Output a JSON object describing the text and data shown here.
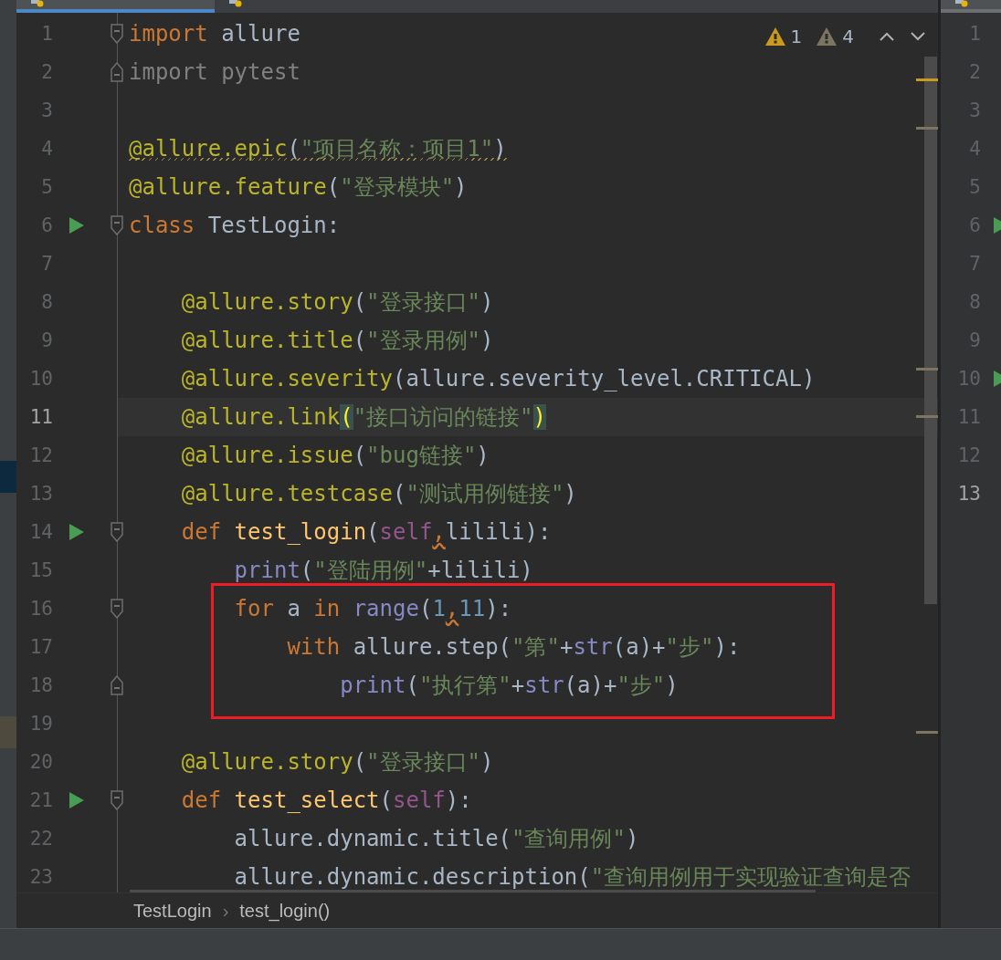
{
  "editor_tabs": [
    {
      "selected": true
    },
    {
      "selected": false
    }
  ],
  "inspections": [
    {
      "kind": "warning",
      "count": "1"
    },
    {
      "kind": "weak-warning",
      "count": "4"
    }
  ],
  "lines": [
    {
      "number": "1",
      "run": false,
      "fold_start": true,
      "fold_end": false,
      "current": false,
      "warned": false,
      "tokens": [
        {
          "kind": "kw",
          "text": "import"
        },
        {
          "kind": "ident",
          "text": " allure"
        }
      ]
    },
    {
      "number": "2",
      "run": false,
      "fold_start": false,
      "fold_end": true,
      "current": false,
      "warned": false,
      "tokens": [
        {
          "kind": "dim",
          "text": "import pytest"
        }
      ]
    },
    {
      "number": "3",
      "run": false,
      "fold_start": false,
      "fold_end": false,
      "current": false
    },
    {
      "number": "4",
      "run": false,
      "fold_start": false,
      "fold_end": false,
      "current": false,
      "warned": true,
      "tokens": [
        {
          "kind": "deco",
          "text": "@allure.epic"
        },
        {
          "kind": "ident",
          "text": "("
        },
        {
          "kind": "str",
          "text": "\"项目名称：项目1\""
        },
        {
          "kind": "ident",
          "text": ")"
        }
      ]
    },
    {
      "number": "5",
      "run": false,
      "fold_start": false,
      "fold_end": false,
      "current": false,
      "warned": false,
      "tokens": [
        {
          "kind": "deco",
          "text": "@allure.feature"
        },
        {
          "kind": "ident",
          "text": "("
        },
        {
          "kind": "str",
          "text": "\"登录模块\""
        },
        {
          "kind": "ident",
          "text": ")"
        }
      ]
    },
    {
      "number": "6",
      "run": true,
      "fold_start": true,
      "fold_end": false,
      "current": false,
      "warned": false,
      "tokens": [
        {
          "kind": "kw",
          "text": "class"
        },
        {
          "kind": "ident",
          "text": " TestLogin:"
        }
      ]
    },
    {
      "number": "7",
      "run": false,
      "fold_start": false,
      "fold_end": false,
      "current": false
    },
    {
      "number": "8",
      "run": false,
      "fold_start": false,
      "fold_end": false,
      "current": false,
      "warned": false,
      "tokens": [
        {
          "kind": "deco",
          "text": "    @allure.story"
        },
        {
          "kind": "ident",
          "text": "("
        },
        {
          "kind": "str",
          "text": "\"登录接口\""
        },
        {
          "kind": "ident",
          "text": ")"
        }
      ]
    },
    {
      "number": "9",
      "run": false,
      "fold_start": false,
      "fold_end": false,
      "current": false,
      "warned": false,
      "tokens": [
        {
          "kind": "deco",
          "text": "    @allure.title"
        },
        {
          "kind": "ident",
          "text": "("
        },
        {
          "kind": "str",
          "text": "\"登录用例\""
        },
        {
          "kind": "ident",
          "text": ")"
        }
      ]
    },
    {
      "number": "10",
      "run": false,
      "fold_start": false,
      "fold_end": false,
      "current": false,
      "warned": false,
      "tokens": [
        {
          "kind": "deco",
          "text": "    @allure.severity"
        },
        {
          "kind": "ident",
          "text": "(allure.severity_level.CRITICAL)"
        }
      ]
    },
    {
      "number": "11",
      "run": false,
      "fold_start": false,
      "fold_end": false,
      "current": true,
      "warned": false,
      "tokens": [
        {
          "kind": "deco",
          "text": "    @allure.link"
        },
        {
          "kind": "paren",
          "text": "("
        },
        {
          "kind": "str",
          "text": "\"接口访问的链接\""
        },
        {
          "kind": "paren",
          "text": ")"
        }
      ]
    },
    {
      "number": "12",
      "run": false,
      "fold_start": false,
      "fold_end": false,
      "current": false,
      "warned": false,
      "tokens": [
        {
          "kind": "deco",
          "text": "    @allure.issue"
        },
        {
          "kind": "ident",
          "text": "("
        },
        {
          "kind": "str",
          "text": "\"bug链接\""
        },
        {
          "kind": "ident",
          "text": ")"
        }
      ]
    },
    {
      "number": "13",
      "run": false,
      "fold_start": false,
      "fold_end": false,
      "current": false,
      "warned": false,
      "tokens": [
        {
          "kind": "deco",
          "text": "    @allure.testcase"
        },
        {
          "kind": "ident",
          "text": "("
        },
        {
          "kind": "str",
          "text": "\"测试用例链接\""
        },
        {
          "kind": "ident",
          "text": ")"
        }
      ]
    },
    {
      "number": "14",
      "run": true,
      "fold_start": true,
      "fold_end": false,
      "current": false,
      "warned": false,
      "tokens": [
        {
          "kind": "kw",
          "text": "    def"
        },
        {
          "kind": "fn",
          "text": " test_login"
        },
        {
          "kind": "ident",
          "text": "("
        },
        {
          "kind": "self",
          "text": "self"
        },
        {
          "kind": "comma",
          "text": ","
        },
        {
          "kind": "ident",
          "text": "lilili):"
        }
      ]
    },
    {
      "number": "15",
      "run": false,
      "fold_start": false,
      "fold_end": false,
      "current": false,
      "warned": false,
      "tokens": [
        {
          "kind": "builtin",
          "text": "        print"
        },
        {
          "kind": "ident",
          "text": "("
        },
        {
          "kind": "str",
          "text": "\"登陆用例\""
        },
        {
          "kind": "ident",
          "text": "+lilili)"
        }
      ]
    },
    {
      "number": "16",
      "run": false,
      "fold_start": true,
      "fold_end": false,
      "current": false,
      "warned": false,
      "tokens": [
        {
          "kind": "kw",
          "text": "        for"
        },
        {
          "kind": "ident",
          "text": " a "
        },
        {
          "kind": "kw",
          "text": "in"
        },
        {
          "kind": "builtin",
          "text": " range"
        },
        {
          "kind": "ident",
          "text": "("
        },
        {
          "kind": "num",
          "text": "1"
        },
        {
          "kind": "comma",
          "text": ","
        },
        {
          "kind": "num",
          "text": "11"
        },
        {
          "kind": "ident",
          "text": "):"
        }
      ]
    },
    {
      "number": "17",
      "run": false,
      "fold_start": false,
      "fold_end": false,
      "current": false,
      "warned": false,
      "tokens": [
        {
          "kind": "kw",
          "text": "            with"
        },
        {
          "kind": "ident",
          "text": " allure.step("
        },
        {
          "kind": "str",
          "text": "\"第\""
        },
        {
          "kind": "ident",
          "text": "+"
        },
        {
          "kind": "builtin",
          "text": "str"
        },
        {
          "kind": "ident",
          "text": "(a)+"
        },
        {
          "kind": "str",
          "text": "\"步\""
        },
        {
          "kind": "ident",
          "text": "):"
        }
      ]
    },
    {
      "number": "18",
      "run": false,
      "fold_start": false,
      "fold_end": true,
      "current": false,
      "warned": false,
      "tokens": [
        {
          "kind": "builtin",
          "text": "                print"
        },
        {
          "kind": "ident",
          "text": "("
        },
        {
          "kind": "str",
          "text": "\"执行第\""
        },
        {
          "kind": "ident",
          "text": "+"
        },
        {
          "kind": "builtin",
          "text": "str"
        },
        {
          "kind": "ident",
          "text": "(a)+"
        },
        {
          "kind": "str",
          "text": "\"步\""
        },
        {
          "kind": "ident",
          "text": ")"
        }
      ]
    },
    {
      "number": "19",
      "run": false,
      "fold_start": false,
      "fold_end": false,
      "current": false
    },
    {
      "number": "20",
      "run": false,
      "fold_start": false,
      "fold_end": false,
      "current": false,
      "warned": false,
      "tokens": [
        {
          "kind": "deco",
          "text": "    @allure.story"
        },
        {
          "kind": "ident",
          "text": "("
        },
        {
          "kind": "str",
          "text": "\"登录接口\""
        },
        {
          "kind": "ident",
          "text": ")"
        }
      ]
    },
    {
      "number": "21",
      "run": true,
      "fold_start": true,
      "fold_end": false,
      "current": false,
      "warned": false,
      "tokens": [
        {
          "kind": "kw",
          "text": "    def"
        },
        {
          "kind": "fn",
          "text": " test_select"
        },
        {
          "kind": "ident",
          "text": "("
        },
        {
          "kind": "self",
          "text": "self"
        },
        {
          "kind": "ident",
          "text": "):"
        }
      ]
    },
    {
      "number": "22",
      "run": false,
      "fold_start": false,
      "fold_end": false,
      "current": false,
      "warned": false,
      "tokens": [
        {
          "kind": "ident",
          "text": "        allure.dynamic.title("
        },
        {
          "kind": "str",
          "text": "\"查询用例\""
        },
        {
          "kind": "ident",
          "text": ")"
        }
      ]
    },
    {
      "number": "23",
      "run": false,
      "fold_start": false,
      "fold_end": false,
      "current": false,
      "warned": false,
      "tokens": [
        {
          "kind": "ident",
          "text": "        allure.dynamic.description("
        },
        {
          "kind": "str",
          "text": "\"查询用例用于实现验证查询是否"
        }
      ]
    }
  ],
  "breadcrumbs": [
    "TestLogin",
    "test_login()"
  ],
  "breadcrumb_separator": "›",
  "preview_pane": {
    "tab": {
      "selected": false
    },
    "lines": [
      {
        "number": "1",
        "run": false,
        "current": false
      },
      {
        "number": "2",
        "run": false,
        "current": false
      },
      {
        "number": "3",
        "run": false,
        "current": false
      },
      {
        "number": "4",
        "run": false,
        "current": false
      },
      {
        "number": "5",
        "run": false,
        "current": false
      },
      {
        "number": "6",
        "run": true,
        "current": false
      },
      {
        "number": "7",
        "run": false,
        "current": false
      },
      {
        "number": "8",
        "run": false,
        "current": false
      },
      {
        "number": "9",
        "run": false,
        "current": false
      },
      {
        "number": "10",
        "run": true,
        "current": false
      },
      {
        "number": "11",
        "run": false,
        "current": false
      },
      {
        "number": "12",
        "run": false,
        "current": false
      },
      {
        "number": "13",
        "run": false,
        "current": true
      }
    ]
  }
}
